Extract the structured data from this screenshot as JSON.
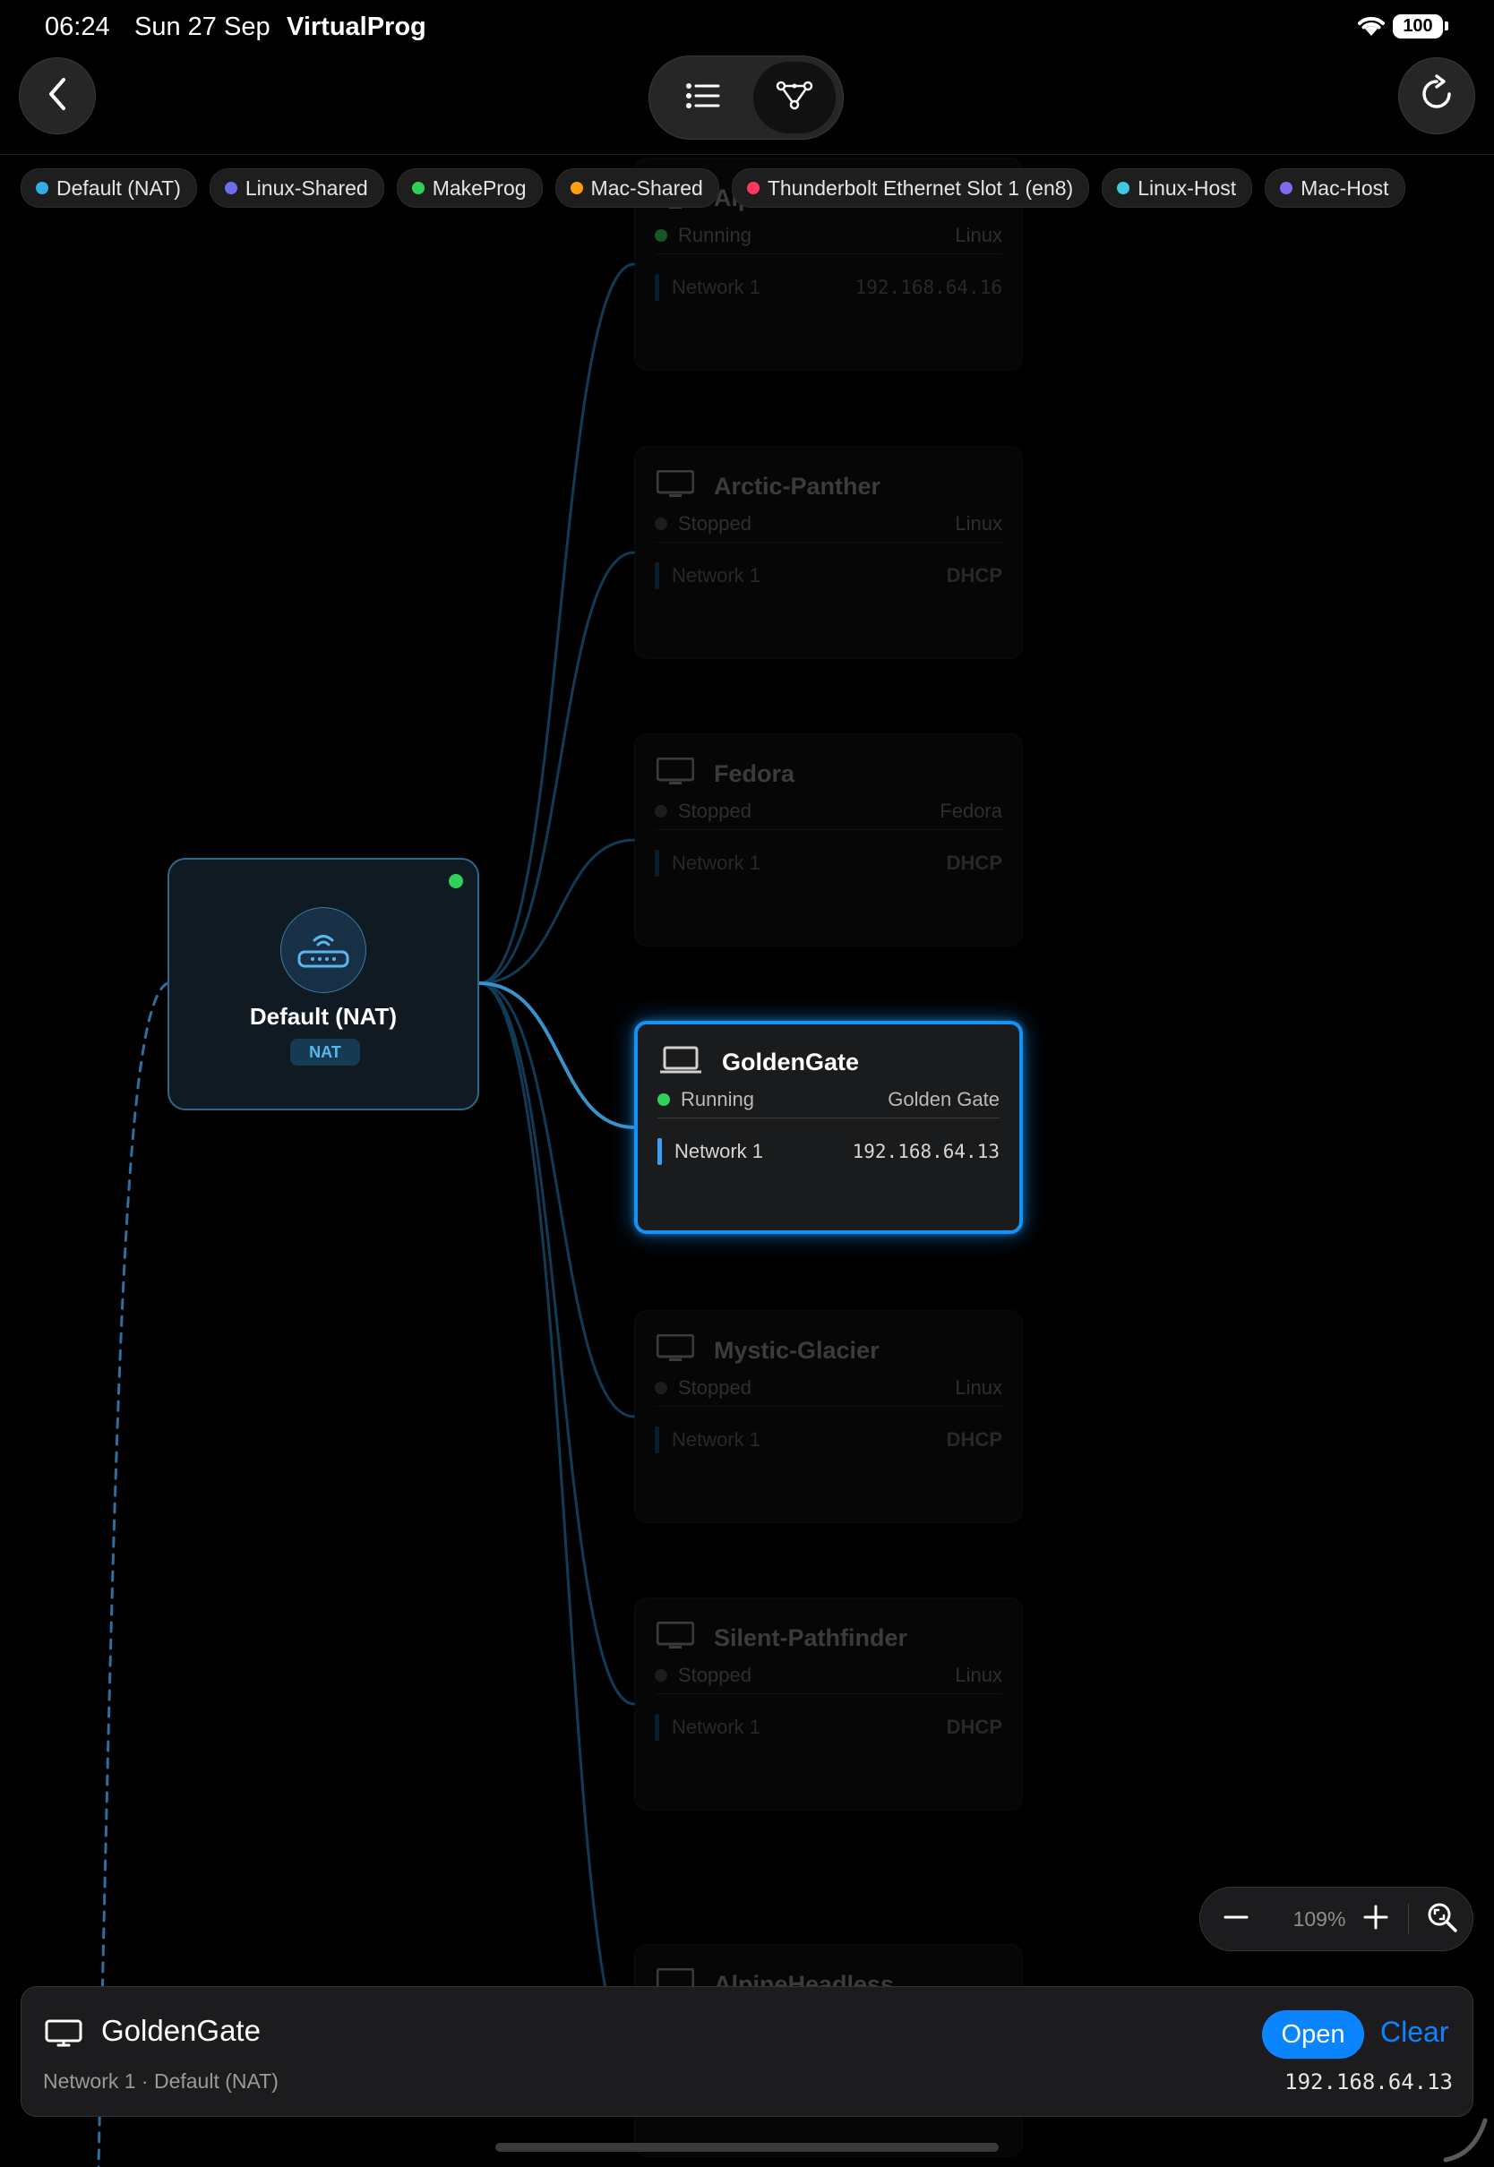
{
  "status_bar": {
    "time": "06:24",
    "date": "Sun 27 Sep",
    "app": "VirtualProg",
    "battery": "100"
  },
  "toolbar": {
    "back": "chevron-left-icon",
    "views": [
      {
        "icon": "list-icon",
        "selected": false
      },
      {
        "icon": "topology-icon",
        "selected": true
      }
    ],
    "refresh": "refresh-icon"
  },
  "networks": [
    {
      "label": "Default (NAT)",
      "color": "#32ade6"
    },
    {
      "label": "Linux-Shared",
      "color": "#6e6cf0"
    },
    {
      "label": "MakeProg",
      "color": "#30d158"
    },
    {
      "label": "Mac-Shared",
      "color": "#ff9f0a"
    },
    {
      "label": "Thunderbolt Ethernet Slot 1 (en8)",
      "color": "#ff375f"
    },
    {
      "label": "Linux-Host",
      "color": "#40c8e0"
    },
    {
      "label": "Mac-Host",
      "color": "#7d6bf0"
    }
  ],
  "nat_node": {
    "title": "Default (NAT)",
    "badge": "NAT",
    "status_color": "#30d158"
  },
  "vms": [
    {
      "name": "Alpine",
      "status": "Running",
      "os": "Linux",
      "network": "Network 1",
      "address": "192.168.64.16"
    },
    {
      "name": "Arctic-Panther",
      "status": "Stopped",
      "os": "Linux",
      "network": "Network 1",
      "address": "DHCP"
    },
    {
      "name": "Fedora",
      "status": "Stopped",
      "os": "Fedora",
      "network": "Network 1",
      "address": "DHCP"
    },
    {
      "name": "GoldenGate",
      "status": "Running",
      "os": "Golden Gate",
      "network": "Network 1",
      "address": "192.168.64.13"
    },
    {
      "name": "Mystic-Glacier",
      "status": "Stopped",
      "os": "Linux",
      "network": "Network 1",
      "address": "DHCP"
    },
    {
      "name": "Silent-Pathfinder",
      "status": "Stopped",
      "os": "Linux",
      "network": "Network 1",
      "address": "DHCP"
    },
    {
      "name": "AlpineHeadless",
      "status": "",
      "os": "",
      "network": "",
      "address": ""
    }
  ],
  "zoom": {
    "value": "109%"
  },
  "selection": {
    "title": "GoldenGate",
    "subtitle": "Network 1 · Default (NAT)",
    "address": "192.168.64.13",
    "open_label": "Open",
    "clear_label": "Clear"
  },
  "colors": {
    "accent": "#0a84ff",
    "running": "#30d158",
    "stopped": "#444444",
    "edge": "#2c7fb0"
  }
}
